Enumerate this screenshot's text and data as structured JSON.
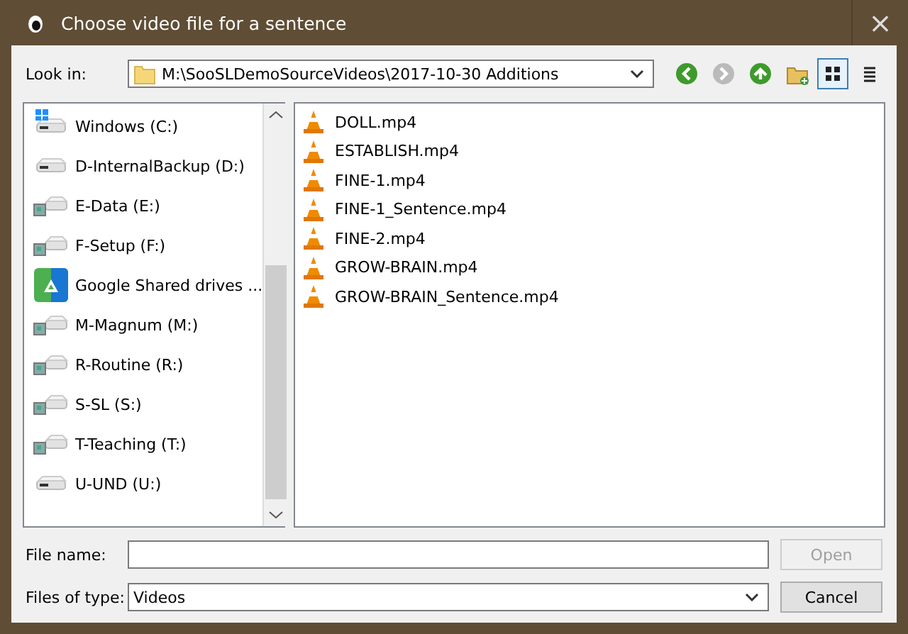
{
  "window": {
    "title": "Choose video file for a sentence",
    "close": "×"
  },
  "look_in": {
    "label": "Look in:",
    "value": "M:\\SooSLDemoSourceVideos\\2017-10-30 Additions"
  },
  "toolbar": [
    {
      "kind": "back",
      "disabled": false,
      "selected": false
    },
    {
      "kind": "forward",
      "disabled": true,
      "selected": false
    },
    {
      "kind": "up",
      "disabled": false,
      "selected": false
    },
    {
      "kind": "new-folder",
      "disabled": false,
      "selected": false
    },
    {
      "kind": "icon-view",
      "disabled": false,
      "selected": true
    },
    {
      "kind": "list-view",
      "disabled": false,
      "selected": false
    }
  ],
  "sidebar": {
    "items": [
      {
        "label": "Windows (C:)",
        "kind": "system"
      },
      {
        "label": "D-InternalBackup (D:)",
        "kind": "drive"
      },
      {
        "label": "E-Data (E:)",
        "kind": "network"
      },
      {
        "label": "F-Setup (F:)",
        "kind": "network"
      },
      {
        "label": "Google Shared drives ...",
        "kind": "cloud"
      },
      {
        "label": "M-Magnum (M:)",
        "kind": "network"
      },
      {
        "label": "R-Routine (R:)",
        "kind": "network"
      },
      {
        "label": "S-SL (S:)",
        "kind": "network"
      },
      {
        "label": "T-Teaching (T:)",
        "kind": "network"
      },
      {
        "label": "U-UND (U:)",
        "kind": "drive"
      }
    ]
  },
  "files": [
    {
      "name": "DOLL.mp4"
    },
    {
      "name": "ESTABLISH.mp4"
    },
    {
      "name": "FINE-1.mp4"
    },
    {
      "name": "FINE-1_Sentence.mp4"
    },
    {
      "name": "FINE-2.mp4"
    },
    {
      "name": "GROW-BRAIN.mp4"
    },
    {
      "name": "GROW-BRAIN_Sentence.mp4"
    }
  ],
  "file_name": {
    "label": "File name:"
  },
  "file_type": {
    "label": "Files of type:",
    "value": "Videos"
  },
  "buttons": [
    {
      "label": "Open",
      "disabled": true
    },
    {
      "label": "Cancel",
      "disabled": false
    }
  ]
}
